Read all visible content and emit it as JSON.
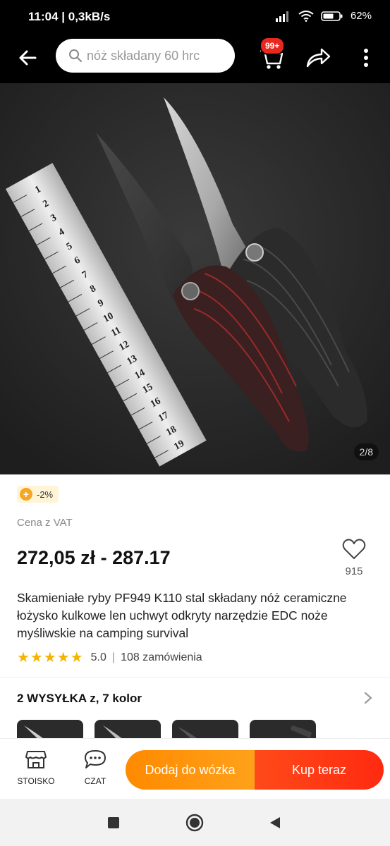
{
  "status_bar": {
    "time": "11:04",
    "speed": "0,3kB/s",
    "battery": "62"
  },
  "search": {
    "placeholder": "nóż składany 60 hrc"
  },
  "cart": {
    "badge": "99+"
  },
  "gallery": {
    "counter": "2/8",
    "icons": [
      "knife-product-photo"
    ]
  },
  "product": {
    "discount": "-2%",
    "vat_label": "Cena z VAT",
    "price": "272,05 zł - 287.17",
    "wish_count": "915",
    "title": "Skamieniałe ryby PF949 K110 stal składany nóż ceramiczne łożysko kulkowe len uchwyt odkryty narzędzie EDC noże myśliwskie na camping survival",
    "rating": "5.0",
    "orders": "108 zamówienia",
    "shipping": "2 WYSYŁKA z, 7 kolor"
  },
  "bottom_bar": {
    "store_label": "STOISKO",
    "chat_label": "CZAT",
    "add_to_cart": "Dodaj do wózka",
    "buy_now": "Kup teraz"
  },
  "ruler": {
    "numbers": [
      "1",
      "2",
      "3",
      "4",
      "5",
      "6",
      "7",
      "8",
      "9",
      "10",
      "11",
      "12",
      "13",
      "14",
      "15",
      "16",
      "17",
      "18",
      "19"
    ]
  },
  "colors": {
    "accent_orange": "#ff8a00",
    "accent_red": "#ff2a10",
    "star": "#f5b400"
  }
}
